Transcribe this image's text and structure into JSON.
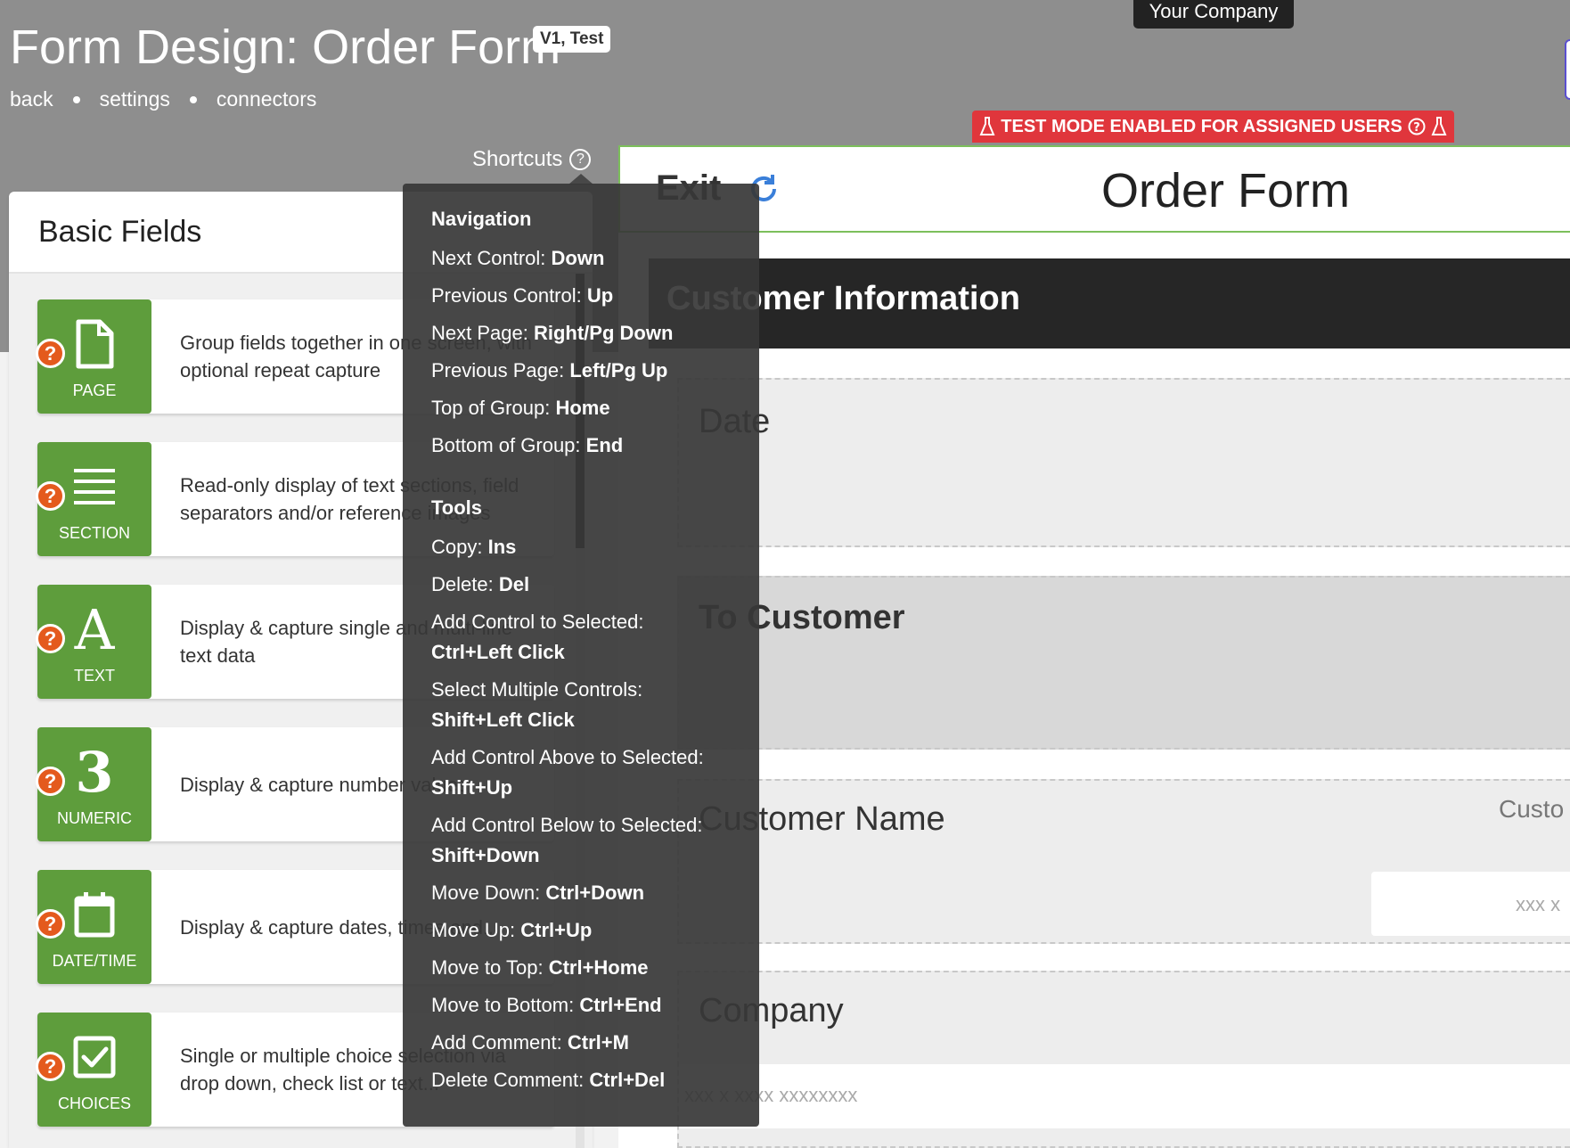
{
  "header": {
    "title": "Form Design: Order Form",
    "version_badge": "V1, Test",
    "nav": [
      "back",
      "settings",
      "connectors"
    ],
    "company": "Your Company",
    "test_banner": "TEST MODE ENABLED FOR ASSIGNED USERS",
    "shortcuts_label": "Shortcuts",
    "accent_color": "#5e9d3c",
    "banner_color": "#e0363c"
  },
  "left_panel": {
    "title": "Basic Fields",
    "fields": [
      {
        "label": "PAGE",
        "icon": "page-icon",
        "description": "Group fields together in one screen, with optional repeat capture"
      },
      {
        "label": "SECTION",
        "icon": "section-lines-icon",
        "description": "Read-only display of text sections, field separators and/or reference images"
      },
      {
        "label": "TEXT",
        "icon": "text-a-icon",
        "glyph": "A",
        "description": "Display & capture single and multi-line text data"
      },
      {
        "label": "NUMERIC",
        "icon": "numeric-3-icon",
        "glyph": "3",
        "description": "Display & capture number values"
      },
      {
        "label": "DATE/TIME",
        "icon": "calendar-icon",
        "description": "Display & capture dates, times and..."
      },
      {
        "label": "CHOICES",
        "icon": "checkbox-icon",
        "description": "Single or multiple choice selection via drop down, check list or text..."
      }
    ]
  },
  "shortcuts": {
    "navigation_heading": "Navigation",
    "navigation": [
      {
        "action": "Next Control:",
        "keys": "Down"
      },
      {
        "action": "Previous Control:",
        "keys": "Up"
      },
      {
        "action": "Next Page:",
        "keys": "Right/Pg Down"
      },
      {
        "action": "Previous Page:",
        "keys": "Left/Pg Up"
      },
      {
        "action": "Top of Group:",
        "keys": "Home"
      },
      {
        "action": "Bottom of Group:",
        "keys": "End"
      }
    ],
    "tools_heading": "Tools",
    "tools": [
      {
        "action": "Copy:",
        "keys": "Ins"
      },
      {
        "action": "Delete:",
        "keys": "Del"
      },
      {
        "action": "Add Control to Selected:",
        "keys": "Ctrl+Left Click"
      },
      {
        "action": "Select Multiple Controls:",
        "keys": "Shift+Left Click"
      },
      {
        "action": "Add Control Above to Selected:",
        "keys": "Shift+Up"
      },
      {
        "action": "Add Control Below to Selected:",
        "keys": "Shift+Down"
      },
      {
        "action": "Move Down:",
        "keys": "Ctrl+Down"
      },
      {
        "action": "Move Up:",
        "keys": "Ctrl+Up"
      },
      {
        "action": "Move to Top:",
        "keys": "Ctrl+Home"
      },
      {
        "action": "Move to Bottom:",
        "keys": "Ctrl+End"
      },
      {
        "action": "Add Comment:",
        "keys": "Ctrl+M"
      },
      {
        "action": "Delete Comment:",
        "keys": "Ctrl+Del"
      }
    ]
  },
  "form": {
    "exit_label": "Exit",
    "title": "Order Form",
    "section_title": "Customer Information",
    "controls": {
      "date_label": "Date",
      "to_customer_label": "To Customer",
      "customer_name_label": "Customer Name",
      "customer_name_hint": "Custo",
      "customer_name_placeholder": "xxx x",
      "company_label": "Company",
      "company_placeholder": "xxx x xxxx xxxxxxxx"
    }
  }
}
